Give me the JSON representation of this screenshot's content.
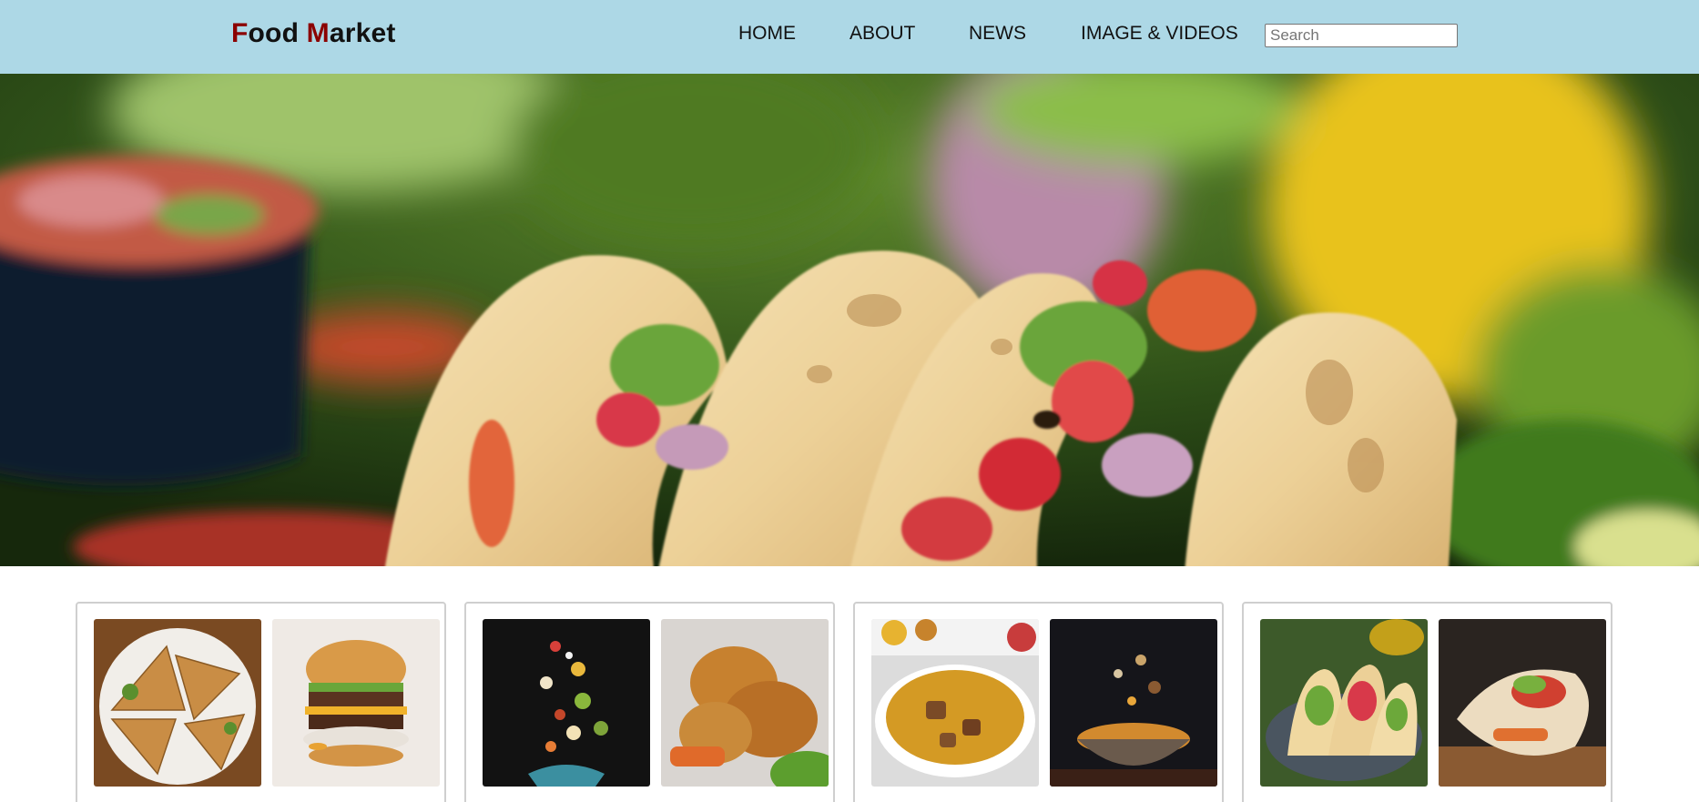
{
  "header": {
    "logo_first_letter": "F",
    "logo_rest_first": "ood ",
    "logo_second_letter": "M",
    "logo_rest_second": "arket",
    "nav": [
      "HOME",
      "ABOUT",
      "NEWS",
      "IMAGE & VIDEOS"
    ],
    "search_placeholder": "Search"
  },
  "colors": {
    "header_bg": "#add8e6",
    "logo_accent": "#8b0000"
  },
  "hero": {
    "image": "tacos-photo"
  },
  "cards": [
    {
      "images": [
        "quesadilla-photo",
        "burger-photo"
      ]
    },
    {
      "images": [
        "flying-salad-bowl-photo",
        "fried-chicken-photo"
      ]
    },
    {
      "images": [
        "biryani-rice-photo",
        "flying-rice-bowl-photo"
      ]
    },
    {
      "images": [
        "tacos-plate-photo",
        "burrito-wrap-photo"
      ]
    }
  ]
}
